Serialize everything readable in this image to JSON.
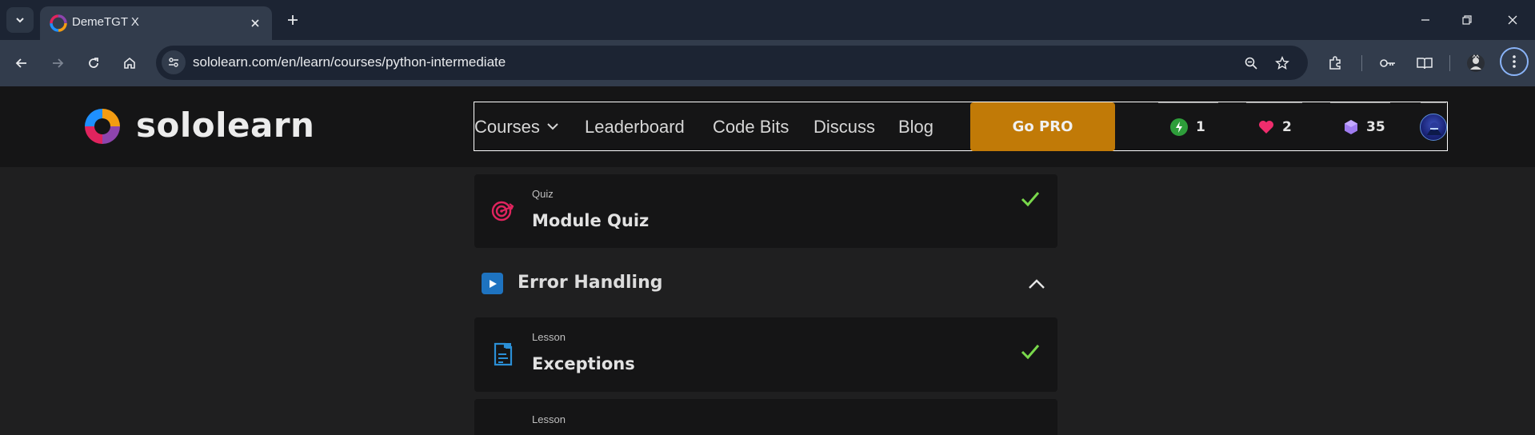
{
  "browser": {
    "tab": {
      "title": "DemeTGT X",
      "favicon": "sololearn-favicon"
    },
    "url": "sololearn.com/en/learn/courses/python-intermediate",
    "icons": [
      "tab-search-icon",
      "close-icon",
      "plus-icon",
      "minimize-icon",
      "restore-icon",
      "close-window-icon",
      "back-icon",
      "forward-icon",
      "reload-icon",
      "home-icon",
      "site-info-icon",
      "zoom-icon",
      "star-icon",
      "extensions-icon",
      "password-key-icon",
      "reading-mode-icon",
      "profile-icon",
      "menu-icon"
    ]
  },
  "header": {
    "brand": "sololearn",
    "nav": [
      {
        "label": "Courses",
        "has_dropdown": true
      },
      {
        "label": "Leaderboard"
      },
      {
        "label": "Code Bits"
      },
      {
        "label": "Discuss"
      },
      {
        "label": "Blog"
      }
    ],
    "go_pro": "Go PRO",
    "stats": {
      "streak": {
        "value": "1",
        "icon": "lightning-icon",
        "color": "#2e9e3a"
      },
      "hearts": {
        "value": "2",
        "icon": "heart-icon",
        "color": "#ef2d6d"
      },
      "gems": {
        "value": "35",
        "icon": "gem-icon",
        "color": "#9f7cf0"
      }
    },
    "colors": {
      "go_pro_bg": "#c17a07",
      "header_bg": "#151516"
    }
  },
  "content": {
    "cards": [
      {
        "type": "Quiz",
        "title": "Module Quiz",
        "completed": true,
        "icon": "target-icon"
      },
      {
        "type": "Lesson",
        "title": "Exceptions",
        "completed": true,
        "icon": "lesson-icon"
      },
      {
        "type": "Lesson",
        "title": "",
        "completed": false,
        "icon": "lesson-icon"
      }
    ],
    "section": {
      "title": "Error Handling",
      "expanded": true,
      "icon": "play-icon"
    },
    "colors": {
      "check": "#79d84b",
      "quiz_icon": "#e0245e",
      "lesson_icon": "#2b8fd6"
    }
  }
}
